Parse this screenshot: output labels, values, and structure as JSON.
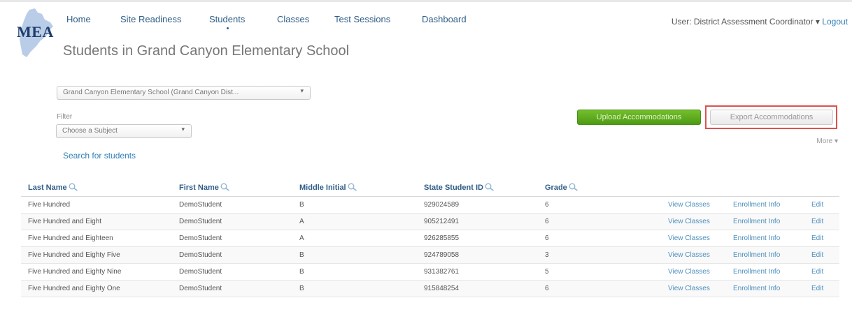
{
  "logo": {
    "text": "MEA"
  },
  "nav": {
    "items": [
      "Home",
      "Site Readiness",
      "Students",
      "Classes",
      "Test Sessions",
      "Dashboard"
    ],
    "active": "Students"
  },
  "user": {
    "label": "User: District Assessment Coordinator",
    "separator": "▾",
    "logout": "Logout"
  },
  "page": {
    "title": "Students in Grand Canyon Elementary School"
  },
  "school_select": {
    "value": "Grand Canyon Elementary School (Grand Canyon Dist..."
  },
  "filter": {
    "label": "Filter",
    "subject_placeholder": "Choose a Subject"
  },
  "search_link": "Search for students",
  "buttons": {
    "upload": "Upload Accommodations",
    "export": "Export Accommodations",
    "more": "More ▾"
  },
  "table": {
    "columns": [
      "Last Name",
      "First Name",
      "Middle Initial",
      "State Student ID",
      "Grade"
    ],
    "actions": [
      "View Classes",
      "Enrollment Info",
      "Edit"
    ],
    "rows": [
      [
        "Five Hundred",
        "DemoStudent",
        "B",
        "929024589",
        "6"
      ],
      [
        "Five Hundred and Eight",
        "DemoStudent",
        "A",
        "905212491",
        "6"
      ],
      [
        "Five Hundred and Eighteen",
        "DemoStudent",
        "A",
        "926285855",
        "6"
      ],
      [
        "Five Hundred and Eighty Five",
        "DemoStudent",
        "B",
        "924789058",
        "3"
      ],
      [
        "Five Hundred and Eighty Nine",
        "DemoStudent",
        "B",
        "931382761",
        "5"
      ],
      [
        "Five Hundred and Eighty One",
        "DemoStudent",
        "B",
        "915848254",
        "6"
      ]
    ]
  },
  "colors": {
    "link": "#2f5d87",
    "accent_green": "#5aa81d",
    "highlight": "#d9534f"
  }
}
